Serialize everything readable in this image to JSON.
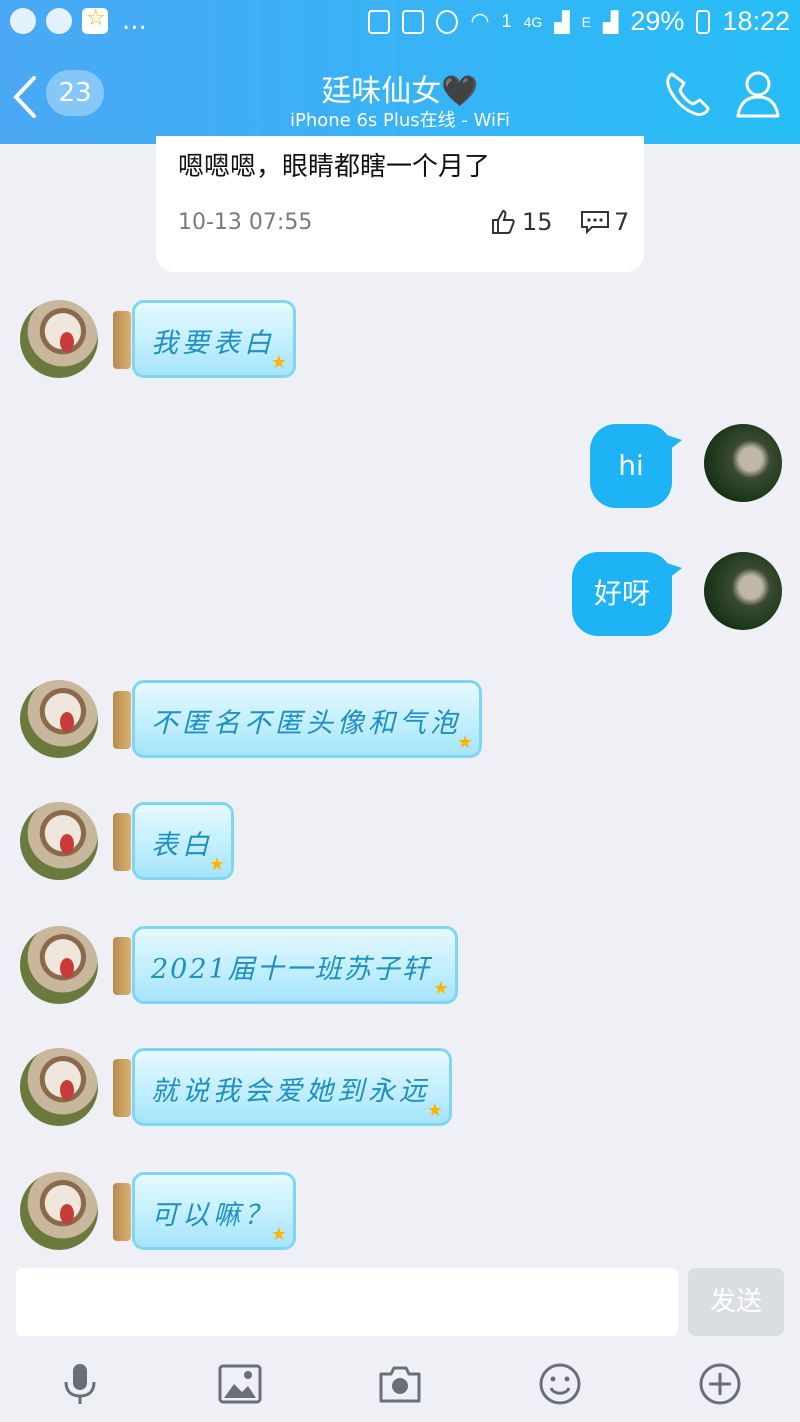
{
  "status_bar": {
    "icons": [
      "qq-icon",
      "wechat-icon",
      "star-app-icon"
    ],
    "more": "...",
    "battery": "29%",
    "time": "18:22",
    "network": "4G",
    "network2": "E",
    "sim": "1"
  },
  "header": {
    "back_count": "23",
    "title": "廷味仙女🖤",
    "subtitle": "iPhone 6s Plus在线 - WiFi"
  },
  "feed_card": {
    "text": "嗯嗯嗯，眼睛都瞎一个月了",
    "time": "10-13 07:55",
    "likes": "15",
    "comments": "7"
  },
  "messages": [
    {
      "from": "other",
      "text": "我要表白"
    },
    {
      "from": "me",
      "text": "hi"
    },
    {
      "from": "me",
      "text": "好呀"
    },
    {
      "from": "other",
      "text": "不匿名不匿头像和气泡"
    },
    {
      "from": "other",
      "text": "表白"
    },
    {
      "from": "other",
      "text": "2021届十一班苏子轩"
    },
    {
      "from": "other",
      "text": "就说我会爱她到永远"
    },
    {
      "from": "other",
      "text": "可以嘛？"
    }
  ],
  "input": {
    "placeholder": "",
    "send_label": "发送"
  },
  "toolbar": [
    "microphone-icon",
    "image-icon",
    "camera-icon",
    "emoji-icon",
    "plus-icon"
  ],
  "colors": {
    "header": "#27bdf7",
    "bubble_me": "#1eb3f4",
    "background": "#eef0f5"
  }
}
